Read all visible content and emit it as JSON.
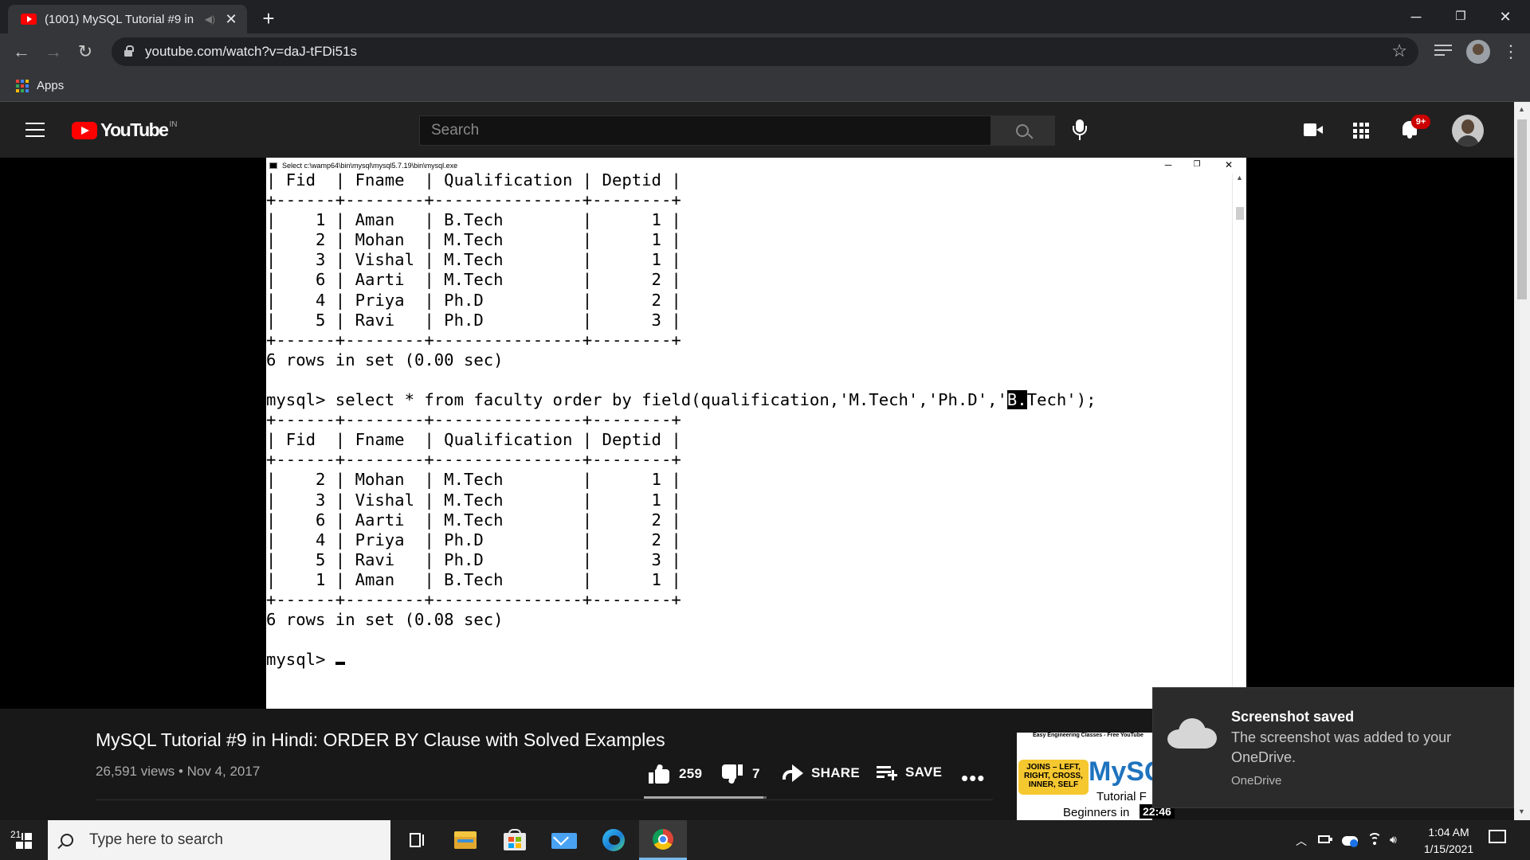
{
  "browser": {
    "tab_title": "(1001) MySQL Tutorial #9 in",
    "url": "youtube.com/watch?v=daJ-tFDi51s",
    "bookmarks_apps_label": "Apps"
  },
  "youtube": {
    "wordmark": "YouTube",
    "country": "IN",
    "search_placeholder": "Search",
    "notification_badge": "9+"
  },
  "console": {
    "window_title": "Select c:\\wamp64\\bin\\mysql\\mysql5.7.19\\bin\\mysql.exe",
    "header_row": "| Fid  | Fname  | Qualification | Deptid |",
    "border_row": "+------+--------+---------------+--------+",
    "table1_rows": [
      "|    1 | Aman   | B.Tech        |      1 |",
      "|    2 | Mohan  | M.Tech        |      1 |",
      "|    3 | Vishal | M.Tech        |      1 |",
      "|    6 | Aarti  | M.Tech        |      2 |",
      "|    4 | Priya  | Ph.D          |      2 |",
      "|    5 | Ravi   | Ph.D          |      3 |"
    ],
    "result1": "6 rows in set (0.00 sec)",
    "query_prefix": "mysql> select * from faculty order by field(qualification,'M.Tech','Ph.D','",
    "query_highlight": "B.",
    "query_suffix": "Tech');",
    "table2_rows": [
      "|    2 | Mohan  | M.Tech        |      1 |",
      "|    3 | Vishal | M.Tech        |      1 |",
      "|    6 | Aarti  | M.Tech        |      2 |",
      "|    4 | Priya  | Ph.D          |      2 |",
      "|    5 | Ravi   | Ph.D          |      3 |",
      "|    1 | Aman   | B.Tech        |      1 |"
    ],
    "result2": "6 rows in set (0.08 sec)",
    "prompt": "mysql> "
  },
  "video": {
    "title": "MySQL Tutorial #9 in Hindi: ORDER BY Clause with Solved Examples",
    "meta": "26,591 views • Nov 4, 2017",
    "likes": "259",
    "dislikes": "7",
    "like_ratio": 0.974,
    "share_label": "SHARE",
    "save_label": "SAVE"
  },
  "suggested": {
    "thumb_header": "Easy Engineering Classes - Free YouTube",
    "thumb_badge": "JOINS – LEFT, RIGHT, CROSS, INNER, SELF",
    "thumb_logo": "MySQ",
    "thumb_line1": "Tutorial F",
    "thumb_line2": "Beginners in",
    "duration": "22:46"
  },
  "toast": {
    "title": "Screenshot saved",
    "body": "The screenshot was added to your OneDrive.",
    "source": "OneDrive"
  },
  "taskbar": {
    "search_placeholder": "Type here to search",
    "time": "1:04 AM",
    "date": "1/15/2021",
    "notification_count": "21"
  }
}
